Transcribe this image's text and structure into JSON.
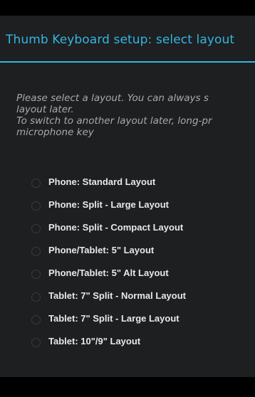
{
  "dialog": {
    "title": "Thumb Keyboard setup: select layout",
    "instructions": [
      "Please select a layout. You can always s",
      "layout later.",
      "To switch to another layout later, long-pr",
      "microphone key"
    ],
    "layouts": [
      "Phone: Standard Layout",
      "Phone: Split - Large Layout",
      "Phone: Split - Compact Layout",
      "Phone/Tablet: 5\" Layout",
      "Phone/Tablet: 5\" Alt Layout",
      "Tablet: 7\" Split - Normal Layout",
      "Tablet: 7\" Split - Large Layout",
      "Tablet: 10\"/9\" Layout"
    ]
  },
  "colors": {
    "accent": "#33b5e5",
    "dialog_background": "#1e1f20",
    "instruction_text": "#a9a9a9",
    "option_text": "#e8e8e8"
  }
}
